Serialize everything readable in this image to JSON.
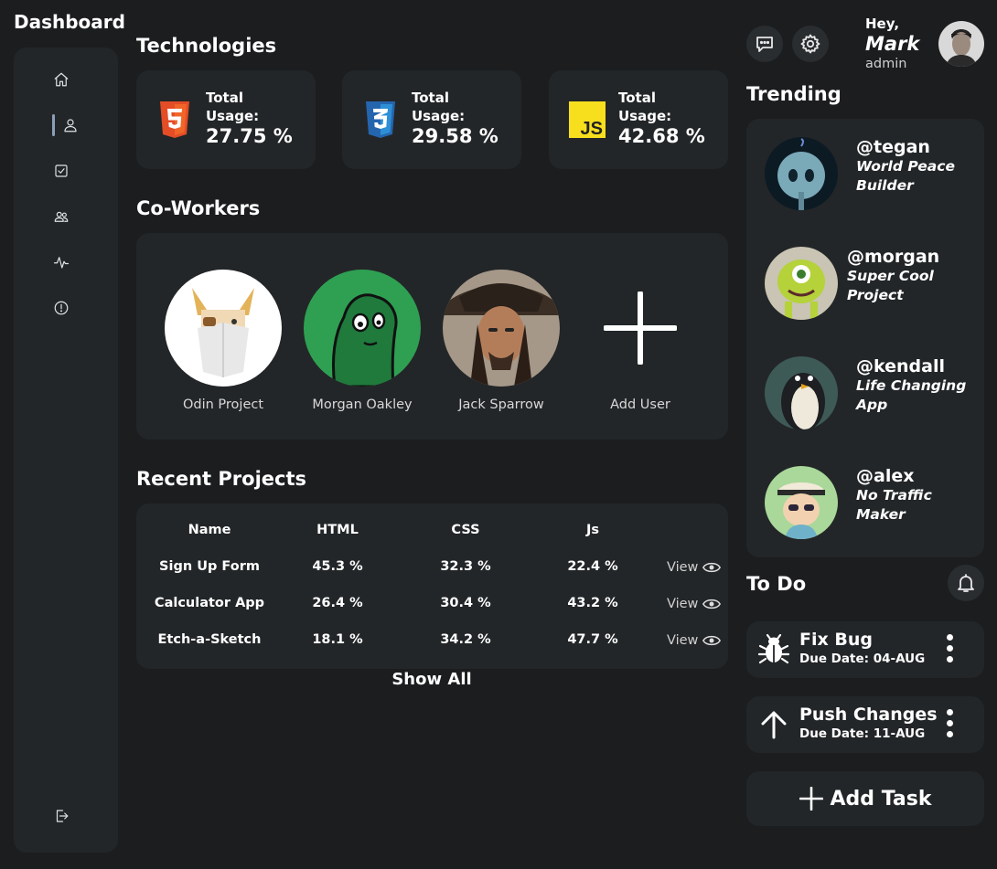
{
  "app": {
    "title": "Dashboard"
  },
  "sidebar": {
    "items": [
      {
        "name": "home",
        "icon": "home-icon"
      },
      {
        "name": "profile",
        "icon": "user-icon",
        "active": true
      },
      {
        "name": "tasks",
        "icon": "checkbox-icon"
      },
      {
        "name": "team",
        "icon": "users-icon"
      },
      {
        "name": "activity",
        "icon": "activity-icon"
      },
      {
        "name": "info",
        "icon": "alert-circle-icon"
      }
    ],
    "logout_icon": "logout-icon"
  },
  "technologies": {
    "title": "Technologies",
    "cards": [
      {
        "label_line1": "Total",
        "label_line2": "Usage:",
        "value": "27.75 %",
        "icon": "html5-icon",
        "color": "#e44d26"
      },
      {
        "label_line1": "Total",
        "label_line2": "Usage:",
        "value": "29.58 %",
        "icon": "css3-icon",
        "color": "#2d8fd5"
      },
      {
        "label_line1": "Total",
        "label_line2": "Usage:",
        "value": "42.68 %",
        "icon": "js-icon",
        "color": "#f7df1e"
      }
    ]
  },
  "coworkers": {
    "title": "Co-Workers",
    "people": [
      {
        "name": "Odin Project"
      },
      {
        "name": "Morgan Oakley"
      },
      {
        "name": "Jack Sparrow"
      }
    ],
    "add_label": "Add User"
  },
  "projects": {
    "title": "Recent Projects",
    "columns": [
      "Name",
      "HTML",
      "CSS",
      "Js"
    ],
    "rows": [
      {
        "name": "Sign Up Form",
        "html": "45.3 %",
        "css": "32.3 %",
        "js": "22.4 %",
        "action": "View"
      },
      {
        "name": "Calculator App",
        "html": "26.4 %",
        "css": "30.4 %",
        "js": "43.2 %",
        "action": "View"
      },
      {
        "name": "Etch-a-Sketch",
        "html": "18.1 %",
        "css": "34.2 %",
        "js": "47.7 %",
        "action": "View"
      }
    ],
    "show_all": "Show All"
  },
  "header": {
    "greeting": "Hey,",
    "user_name": "Mark",
    "user_role": "admin",
    "message_icon": "message-icon",
    "settings_icon": "gear-icon"
  },
  "trending": {
    "title": "Trending",
    "items": [
      {
        "handle": "@tegan",
        "desc": "World Peace Builder"
      },
      {
        "handle": "@morgan",
        "desc": "Super Cool Project"
      },
      {
        "handle": "@kendall",
        "desc": "Life Changing App"
      },
      {
        "handle": "@alex",
        "desc": "No Traffic Maker"
      }
    ]
  },
  "todo": {
    "title": "To Do",
    "bell_icon": "bell-icon",
    "items": [
      {
        "title": "Fix Bug",
        "due": "Due Date: 04-AUG",
        "icon": "bug-icon"
      },
      {
        "title": "Push Changes",
        "due": "Due Date: 11-AUG",
        "icon": "arrow-up-icon"
      }
    ],
    "add_label": "Add Task"
  }
}
